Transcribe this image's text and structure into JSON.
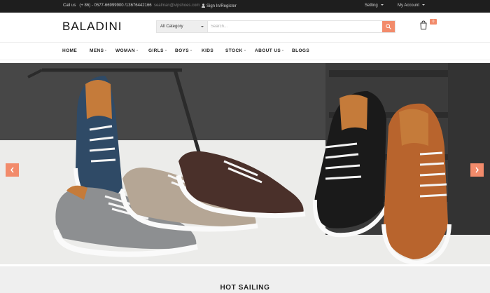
{
  "topbar": {
    "contact_label": "Call us",
    "phone": "(+ 86) - 0577-66999900 /13676442166",
    "email": "sealman@vipshoes.com",
    "signin": "Sign In/Register",
    "setting": "Setting",
    "account": "My Account"
  },
  "header": {
    "logo": "BALADINI",
    "category_selected": "All Category",
    "search_placeholder": "Search...",
    "cart_count": "0"
  },
  "nav": {
    "items": [
      {
        "label": "HOME"
      },
      {
        "label": "MENS"
      },
      {
        "label": "WOMAN"
      },
      {
        "label": "GIRLS"
      },
      {
        "label": "BOYS"
      },
      {
        "label": "KIDS"
      },
      {
        "label": "STOCK"
      },
      {
        "label": "ABOUT US"
      },
      {
        "label": "BLOGS"
      }
    ]
  },
  "hero": {
    "image": "sneakers-banner"
  },
  "section": {
    "title": "HOT SAILING"
  },
  "colors": {
    "accent": "#f28b6b",
    "topbar_bg": "#1e1e1e"
  }
}
